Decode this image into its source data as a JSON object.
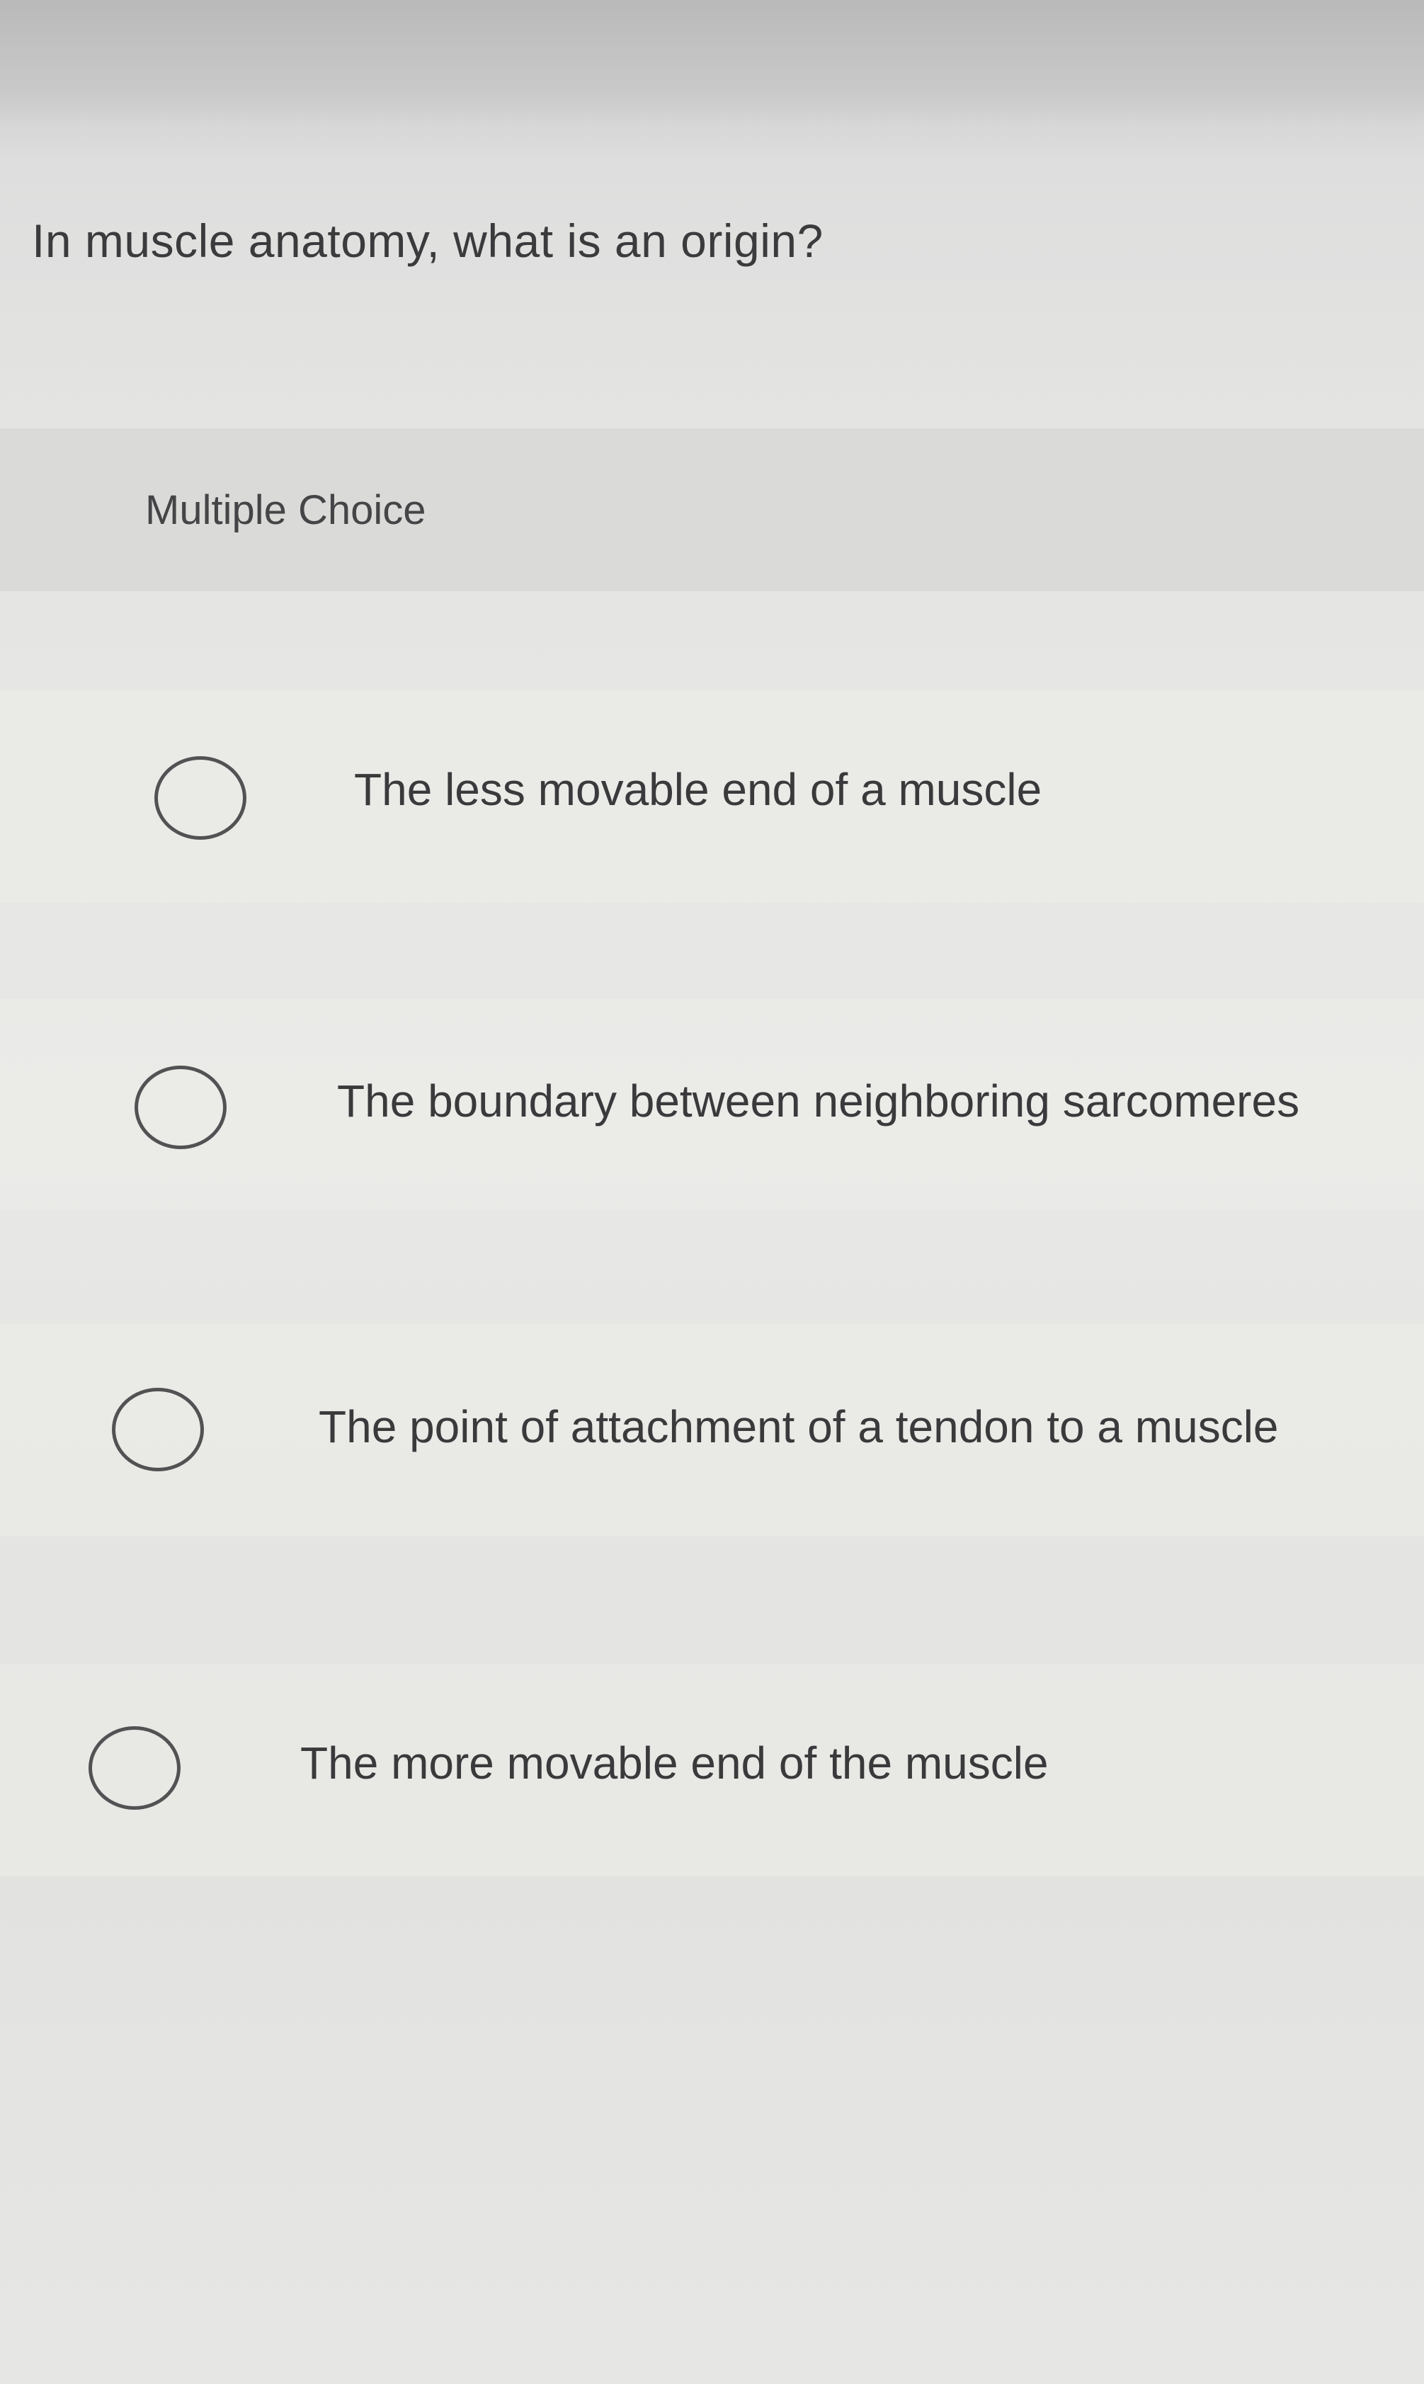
{
  "question": {
    "text": "In muscle anatomy, what is an origin?"
  },
  "question_type": {
    "label": "Multiple Choice"
  },
  "options": [
    {
      "label": "The less movable end of a muscle",
      "selected": false
    },
    {
      "label": "The boundary between neighboring sarcomeres",
      "selected": false
    },
    {
      "label": "The point of attachment of a tendon to a muscle",
      "selected": false
    },
    {
      "label": "The more movable end of the muscle",
      "selected": false
    }
  ],
  "icons": {
    "radio": "radio-unselected-icon"
  }
}
